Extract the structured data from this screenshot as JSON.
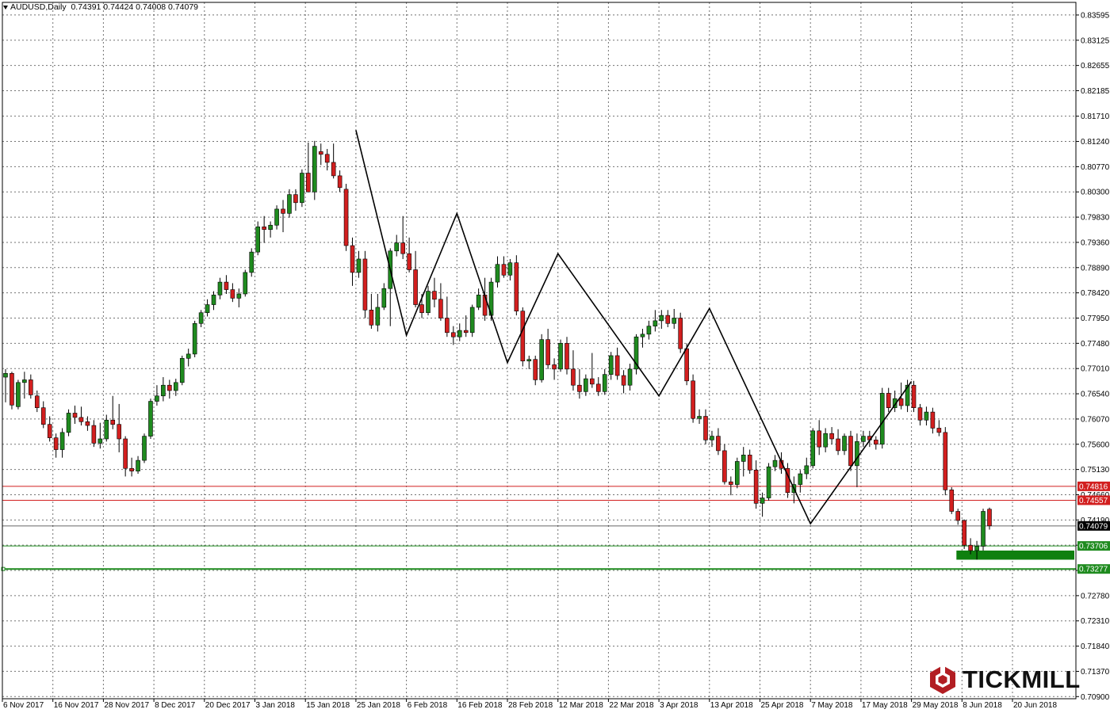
{
  "header": {
    "symbol": "AUDUSD,Daily",
    "ohlc": "0.74391 0.74424 0.74008 0.74079"
  },
  "logo": {
    "text": "TICKMILL",
    "icon": "tickmill-hexagon-icon",
    "color": "#b21e23"
  },
  "colors": {
    "bull": "#1f8b1f",
    "bear": "#d21f1f",
    "resistance": "#d21f1f",
    "support": "#1f8b1f",
    "current_price": "#000000",
    "grid": "#000000"
  },
  "chart_data": {
    "type": "candlestick",
    "symbol": "AUDUSD",
    "timeframe": "Daily",
    "ylim": [
      0.7086,
      0.8383
    ],
    "y_ticks": [
      "0.83595",
      "0.83125",
      "0.82655",
      "0.82185",
      "0.81710",
      "0.81240",
      "0.80770",
      "0.80300",
      "0.79830",
      "0.79360",
      "0.78890",
      "0.78420",
      "0.77950",
      "0.77480",
      "0.77010",
      "0.76540",
      "0.76070",
      "0.75600",
      "0.75130",
      "0.74660",
      "0.74190",
      "0.73720",
      "0.73250",
      "0.72780",
      "0.72310",
      "0.71840",
      "0.71370",
      "0.70900"
    ],
    "x_ticks": [
      "6 Nov 2017",
      "16 Nov 2017",
      "28 Nov 2017",
      "8 Dec 2017",
      "20 Dec 2017",
      "3 Jan 2018",
      "15 Jan 2018",
      "25 Jan 2018",
      "6 Feb 2018",
      "16 Feb 2018",
      "28 Feb 2018",
      "12 Mar 2018",
      "22 Mar 2018",
      "3 Apr 2018",
      "13 Apr 2018",
      "25 Apr 2018",
      "7 May 2018",
      "17 May 2018",
      "29 May 2018",
      "8 Jun 2018",
      "20 Jun 2018"
    ],
    "grid": true,
    "horizontal_levels": [
      {
        "value": 0.74816,
        "label": "0.74816",
        "color": "#d21f1f"
      },
      {
        "value": 0.74557,
        "label": "0.74557",
        "color": "#d21f1f"
      },
      {
        "value": 0.74079,
        "label": "0.74079",
        "color": "#000000",
        "current": true
      },
      {
        "value": 0.73706,
        "label": "0.73706",
        "color": "#1f8b1f"
      },
      {
        "value": 0.73277,
        "label": "0.73277",
        "color": "#1f8b1f"
      }
    ],
    "support_zone": {
      "from": 0.7345,
      "to": 0.7362,
      "start_date": "8 Jun 2018",
      "color": "#0f800f"
    },
    "zigzag": [
      {
        "x": "25 Jan 2018",
        "y": 0.8145
      },
      {
        "x": "6 Feb 2018",
        "y": 0.7763
      },
      {
        "x": "16 Feb 2018",
        "y": 0.799
      },
      {
        "x": "28 Feb 2018",
        "y": 0.7712
      },
      {
        "x": "12 Mar 2018",
        "y": 0.7915
      },
      {
        "x": "3 Apr 2018",
        "y": 0.765
      },
      {
        "x": "13 Apr 2018",
        "y": 0.7813
      },
      {
        "x": "7 May 2018",
        "y": 0.7412
      },
      {
        "x": "29 May 2018",
        "y": 0.7677
      }
    ],
    "candles": [
      {
        "o": 0.7685,
        "h": 0.77,
        "l": 0.7638,
        "c": 0.7692
      },
      {
        "o": 0.7692,
        "h": 0.7695,
        "l": 0.7625,
        "c": 0.7633
      },
      {
        "o": 0.763,
        "h": 0.768,
        "l": 0.7625,
        "c": 0.7675
      },
      {
        "o": 0.7675,
        "h": 0.7695,
        "l": 0.7645,
        "c": 0.768
      },
      {
        "o": 0.768,
        "h": 0.769,
        "l": 0.7645,
        "c": 0.7652
      },
      {
        "o": 0.765,
        "h": 0.766,
        "l": 0.762,
        "c": 0.7628
      },
      {
        "o": 0.7628,
        "h": 0.764,
        "l": 0.759,
        "c": 0.7597
      },
      {
        "o": 0.7597,
        "h": 0.7612,
        "l": 0.7565,
        "c": 0.7572
      },
      {
        "o": 0.7572,
        "h": 0.758,
        "l": 0.7535,
        "c": 0.755
      },
      {
        "o": 0.755,
        "h": 0.759,
        "l": 0.7535,
        "c": 0.7582
      },
      {
        "o": 0.7582,
        "h": 0.7625,
        "l": 0.7575,
        "c": 0.7618
      },
      {
        "o": 0.7618,
        "h": 0.7632,
        "l": 0.7598,
        "c": 0.761
      },
      {
        "o": 0.761,
        "h": 0.763,
        "l": 0.7595,
        "c": 0.7602
      },
      {
        "o": 0.7602,
        "h": 0.7612,
        "l": 0.7585,
        "c": 0.7595
      },
      {
        "o": 0.7595,
        "h": 0.7605,
        "l": 0.7555,
        "c": 0.7562
      },
      {
        "o": 0.7562,
        "h": 0.76,
        "l": 0.7552,
        "c": 0.757
      },
      {
        "o": 0.757,
        "h": 0.7615,
        "l": 0.7565,
        "c": 0.7605
      },
      {
        "o": 0.7605,
        "h": 0.765,
        "l": 0.7588,
        "c": 0.7597
      },
      {
        "o": 0.7597,
        "h": 0.7635,
        "l": 0.7545,
        "c": 0.757
      },
      {
        "o": 0.757,
        "h": 0.7575,
        "l": 0.75,
        "c": 0.7515
      },
      {
        "o": 0.7515,
        "h": 0.7535,
        "l": 0.75,
        "c": 0.751
      },
      {
        "o": 0.751,
        "h": 0.7538,
        "l": 0.7505,
        "c": 0.753
      },
      {
        "o": 0.753,
        "h": 0.758,
        "l": 0.7525,
        "c": 0.7575
      },
      {
        "o": 0.7575,
        "h": 0.7645,
        "l": 0.757,
        "c": 0.764
      },
      {
        "o": 0.764,
        "h": 0.767,
        "l": 0.7632,
        "c": 0.765
      },
      {
        "o": 0.765,
        "h": 0.7685,
        "l": 0.764,
        "c": 0.767
      },
      {
        "o": 0.767,
        "h": 0.768,
        "l": 0.7645,
        "c": 0.766
      },
      {
        "o": 0.766,
        "h": 0.7682,
        "l": 0.765,
        "c": 0.7675
      },
      {
        "o": 0.7675,
        "h": 0.7725,
        "l": 0.767,
        "c": 0.772
      },
      {
        "o": 0.772,
        "h": 0.7738,
        "l": 0.7705,
        "c": 0.7728
      },
      {
        "o": 0.7728,
        "h": 0.779,
        "l": 0.7722,
        "c": 0.7785
      },
      {
        "o": 0.7785,
        "h": 0.781,
        "l": 0.7778,
        "c": 0.7805
      },
      {
        "o": 0.7805,
        "h": 0.783,
        "l": 0.7798,
        "c": 0.782
      },
      {
        "o": 0.782,
        "h": 0.7845,
        "l": 0.781,
        "c": 0.7838
      },
      {
        "o": 0.7838,
        "h": 0.787,
        "l": 0.783,
        "c": 0.7862
      },
      {
        "o": 0.7862,
        "h": 0.7875,
        "l": 0.784,
        "c": 0.7848
      },
      {
        "o": 0.7848,
        "h": 0.786,
        "l": 0.7825,
        "c": 0.7832
      },
      {
        "o": 0.7832,
        "h": 0.785,
        "l": 0.7815,
        "c": 0.784
      },
      {
        "o": 0.784,
        "h": 0.7885,
        "l": 0.7835,
        "c": 0.788
      },
      {
        "o": 0.788,
        "h": 0.7925,
        "l": 0.7872,
        "c": 0.7918
      },
      {
        "o": 0.7918,
        "h": 0.7975,
        "l": 0.7912,
        "c": 0.7965
      },
      {
        "o": 0.7965,
        "h": 0.7985,
        "l": 0.7935,
        "c": 0.796
      },
      {
        "o": 0.796,
        "h": 0.7975,
        "l": 0.7945,
        "c": 0.7968
      },
      {
        "o": 0.7968,
        "h": 0.8005,
        "l": 0.796,
        "c": 0.7998
      },
      {
        "o": 0.7998,
        "h": 0.8015,
        "l": 0.7955,
        "c": 0.799
      },
      {
        "o": 0.799,
        "h": 0.8035,
        "l": 0.7982,
        "c": 0.8025
      },
      {
        "o": 0.8025,
        "h": 0.8035,
        "l": 0.7995,
        "c": 0.801
      },
      {
        "o": 0.801,
        "h": 0.8072,
        "l": 0.8002,
        "c": 0.8065
      },
      {
        "o": 0.8065,
        "h": 0.8122,
        "l": 0.803,
        "c": 0.803
      },
      {
        "o": 0.803,
        "h": 0.8125,
        "l": 0.8015,
        "c": 0.8115
      },
      {
        "o": 0.8105,
        "h": 0.812,
        "l": 0.808,
        "c": 0.81
      },
      {
        "o": 0.81,
        "h": 0.811,
        "l": 0.807,
        "c": 0.8085
      },
      {
        "o": 0.8085,
        "h": 0.812,
        "l": 0.8055,
        "c": 0.806
      },
      {
        "o": 0.806,
        "h": 0.807,
        "l": 0.803,
        "c": 0.8038
      },
      {
        "o": 0.8035,
        "h": 0.8045,
        "l": 0.792,
        "c": 0.793
      },
      {
        "o": 0.793,
        "h": 0.7945,
        "l": 0.7855,
        "c": 0.788
      },
      {
        "o": 0.788,
        "h": 0.792,
        "l": 0.787,
        "c": 0.7905
      },
      {
        "o": 0.7905,
        "h": 0.792,
        "l": 0.7795,
        "c": 0.781
      },
      {
        "o": 0.781,
        "h": 0.784,
        "l": 0.7775,
        "c": 0.7782
      },
      {
        "o": 0.7782,
        "h": 0.784,
        "l": 0.777,
        "c": 0.7815
      },
      {
        "o": 0.7815,
        "h": 0.786,
        "l": 0.781,
        "c": 0.785
      },
      {
        "o": 0.785,
        "h": 0.7925,
        "l": 0.778,
        "c": 0.792
      },
      {
        "o": 0.792,
        "h": 0.795,
        "l": 0.791,
        "c": 0.7935
      },
      {
        "o": 0.7935,
        "h": 0.7985,
        "l": 0.7905,
        "c": 0.7915
      },
      {
        "o": 0.7915,
        "h": 0.7945,
        "l": 0.788,
        "c": 0.7885
      },
      {
        "o": 0.7885,
        "h": 0.792,
        "l": 0.7815,
        "c": 0.782
      },
      {
        "o": 0.782,
        "h": 0.784,
        "l": 0.7795,
        "c": 0.7805
      },
      {
        "o": 0.7805,
        "h": 0.7855,
        "l": 0.78,
        "c": 0.7845
      },
      {
        "o": 0.7845,
        "h": 0.787,
        "l": 0.7815,
        "c": 0.783
      },
      {
        "o": 0.783,
        "h": 0.786,
        "l": 0.779,
        "c": 0.7795
      },
      {
        "o": 0.7795,
        "h": 0.7835,
        "l": 0.776,
        "c": 0.7768
      },
      {
        "o": 0.7768,
        "h": 0.778,
        "l": 0.7745,
        "c": 0.776
      },
      {
        "o": 0.776,
        "h": 0.7785,
        "l": 0.7752,
        "c": 0.7772
      },
      {
        "o": 0.7772,
        "h": 0.78,
        "l": 0.776,
        "c": 0.7768
      },
      {
        "o": 0.7768,
        "h": 0.782,
        "l": 0.776,
        "c": 0.7815
      },
      {
        "o": 0.7815,
        "h": 0.785,
        "l": 0.781,
        "c": 0.7838
      },
      {
        "o": 0.7838,
        "h": 0.787,
        "l": 0.779,
        "c": 0.78
      },
      {
        "o": 0.78,
        "h": 0.787,
        "l": 0.779,
        "c": 0.7862
      },
      {
        "o": 0.7862,
        "h": 0.791,
        "l": 0.7852,
        "c": 0.7895
      },
      {
        "o": 0.7895,
        "h": 0.791,
        "l": 0.787,
        "c": 0.7875
      },
      {
        "o": 0.7875,
        "h": 0.7905,
        "l": 0.7865,
        "c": 0.7898
      },
      {
        "o": 0.7898,
        "h": 0.7912,
        "l": 0.78,
        "c": 0.7808
      },
      {
        "o": 0.7808,
        "h": 0.7815,
        "l": 0.7705,
        "c": 0.7715
      },
      {
        "o": 0.7715,
        "h": 0.7725,
        "l": 0.77,
        "c": 0.7718
      },
      {
        "o": 0.7718,
        "h": 0.7725,
        "l": 0.767,
        "c": 0.768
      },
      {
        "o": 0.768,
        "h": 0.7765,
        "l": 0.7675,
        "c": 0.7755
      },
      {
        "o": 0.7755,
        "h": 0.7775,
        "l": 0.77,
        "c": 0.7708
      },
      {
        "o": 0.7708,
        "h": 0.772,
        "l": 0.768,
        "c": 0.77
      },
      {
        "o": 0.77,
        "h": 0.7755,
        "l": 0.7695,
        "c": 0.7748
      },
      {
        "o": 0.7748,
        "h": 0.776,
        "l": 0.769,
        "c": 0.77
      },
      {
        "o": 0.77,
        "h": 0.7735,
        "l": 0.766,
        "c": 0.767
      },
      {
        "o": 0.767,
        "h": 0.77,
        "l": 0.7645,
        "c": 0.7658
      },
      {
        "o": 0.7658,
        "h": 0.769,
        "l": 0.765,
        "c": 0.7682
      },
      {
        "o": 0.7682,
        "h": 0.773,
        "l": 0.7665,
        "c": 0.7672
      },
      {
        "o": 0.7672,
        "h": 0.7685,
        "l": 0.765,
        "c": 0.7658
      },
      {
        "o": 0.7658,
        "h": 0.77,
        "l": 0.7652,
        "c": 0.769
      },
      {
        "o": 0.769,
        "h": 0.7732,
        "l": 0.768,
        "c": 0.7725
      },
      {
        "o": 0.7725,
        "h": 0.774,
        "l": 0.768,
        "c": 0.7688
      },
      {
        "o": 0.7688,
        "h": 0.7698,
        "l": 0.7655,
        "c": 0.767
      },
      {
        "o": 0.767,
        "h": 0.771,
        "l": 0.766,
        "c": 0.77
      },
      {
        "o": 0.77,
        "h": 0.7765,
        "l": 0.769,
        "c": 0.776
      },
      {
        "o": 0.776,
        "h": 0.7775,
        "l": 0.774,
        "c": 0.7765
      },
      {
        "o": 0.7765,
        "h": 0.779,
        "l": 0.7755,
        "c": 0.778
      },
      {
        "o": 0.778,
        "h": 0.781,
        "l": 0.777,
        "c": 0.779
      },
      {
        "o": 0.779,
        "h": 0.781,
        "l": 0.7775,
        "c": 0.78
      },
      {
        "o": 0.78,
        "h": 0.781,
        "l": 0.7778,
        "c": 0.7785
      },
      {
        "o": 0.7785,
        "h": 0.7812,
        "l": 0.7775,
        "c": 0.7795
      },
      {
        "o": 0.7795,
        "h": 0.7805,
        "l": 0.773,
        "c": 0.7738
      },
      {
        "o": 0.7738,
        "h": 0.7748,
        "l": 0.767,
        "c": 0.7678
      },
      {
        "o": 0.7678,
        "h": 0.769,
        "l": 0.76,
        "c": 0.7608
      },
      {
        "o": 0.7608,
        "h": 0.7625,
        "l": 0.7598,
        "c": 0.7612
      },
      {
        "o": 0.7612,
        "h": 0.7625,
        "l": 0.756,
        "c": 0.7568
      },
      {
        "o": 0.7568,
        "h": 0.7585,
        "l": 0.7555,
        "c": 0.7575
      },
      {
        "o": 0.7575,
        "h": 0.759,
        "l": 0.754,
        "c": 0.7548
      },
      {
        "o": 0.7548,
        "h": 0.756,
        "l": 0.7485,
        "c": 0.749
      },
      {
        "o": 0.749,
        "h": 0.75,
        "l": 0.7465,
        "c": 0.7485
      },
      {
        "o": 0.7485,
        "h": 0.7535,
        "l": 0.7478,
        "c": 0.7528
      },
      {
        "o": 0.7528,
        "h": 0.7555,
        "l": 0.75,
        "c": 0.754
      },
      {
        "o": 0.754,
        "h": 0.755,
        "l": 0.7505,
        "c": 0.7512
      },
      {
        "o": 0.7512,
        "h": 0.753,
        "l": 0.744,
        "c": 0.745
      },
      {
        "o": 0.745,
        "h": 0.747,
        "l": 0.7425,
        "c": 0.746
      },
      {
        "o": 0.746,
        "h": 0.7525,
        "l": 0.7455,
        "c": 0.7518
      },
      {
        "o": 0.7518,
        "h": 0.754,
        "l": 0.751,
        "c": 0.753
      },
      {
        "o": 0.753,
        "h": 0.7545,
        "l": 0.7505,
        "c": 0.7515
      },
      {
        "o": 0.7515,
        "h": 0.7525,
        "l": 0.746,
        "c": 0.747
      },
      {
        "o": 0.747,
        "h": 0.75,
        "l": 0.745,
        "c": 0.7485
      },
      {
        "o": 0.7485,
        "h": 0.7512,
        "l": 0.747,
        "c": 0.7505
      },
      {
        "o": 0.7505,
        "h": 0.7535,
        "l": 0.7495,
        "c": 0.752
      },
      {
        "o": 0.752,
        "h": 0.759,
        "l": 0.7515,
        "c": 0.7585
      },
      {
        "o": 0.7585,
        "h": 0.7605,
        "l": 0.754,
        "c": 0.7555
      },
      {
        "o": 0.7555,
        "h": 0.759,
        "l": 0.7545,
        "c": 0.758
      },
      {
        "o": 0.758,
        "h": 0.7592,
        "l": 0.756,
        "c": 0.757
      },
      {
        "o": 0.757,
        "h": 0.7588,
        "l": 0.754,
        "c": 0.7548
      },
      {
        "o": 0.7548,
        "h": 0.758,
        "l": 0.754,
        "c": 0.7575
      },
      {
        "o": 0.7575,
        "h": 0.7585,
        "l": 0.751,
        "c": 0.752
      },
      {
        "o": 0.752,
        "h": 0.758,
        "l": 0.748,
        "c": 0.7565
      },
      {
        "o": 0.7565,
        "h": 0.7585,
        "l": 0.7555,
        "c": 0.7575
      },
      {
        "o": 0.7575,
        "h": 0.7585,
        "l": 0.7555,
        "c": 0.7568
      },
      {
        "o": 0.7568,
        "h": 0.7575,
        "l": 0.755,
        "c": 0.756
      },
      {
        "o": 0.756,
        "h": 0.7665,
        "l": 0.7552,
        "c": 0.7655
      },
      {
        "o": 0.7655,
        "h": 0.7665,
        "l": 0.762,
        "c": 0.7628
      },
      {
        "o": 0.7628,
        "h": 0.766,
        "l": 0.762,
        "c": 0.7645
      },
      {
        "o": 0.7645,
        "h": 0.7675,
        "l": 0.7625,
        "c": 0.7632
      },
      {
        "o": 0.7632,
        "h": 0.768,
        "l": 0.762,
        "c": 0.767
      },
      {
        "o": 0.767,
        "h": 0.7678,
        "l": 0.762,
        "c": 0.7628
      },
      {
        "o": 0.7628,
        "h": 0.7635,
        "l": 0.7595,
        "c": 0.7605
      },
      {
        "o": 0.7605,
        "h": 0.763,
        "l": 0.7595,
        "c": 0.762
      },
      {
        "o": 0.762,
        "h": 0.7628,
        "l": 0.758,
        "c": 0.759
      },
      {
        "o": 0.759,
        "h": 0.7605,
        "l": 0.7575,
        "c": 0.7582
      },
      {
        "o": 0.7582,
        "h": 0.7592,
        "l": 0.7465,
        "c": 0.7475
      },
      {
        "o": 0.7475,
        "h": 0.748,
        "l": 0.743,
        "c": 0.7435
      },
      {
        "o": 0.7435,
        "h": 0.744,
        "l": 0.741,
        "c": 0.7418
      },
      {
        "o": 0.7418,
        "h": 0.742,
        "l": 0.7365,
        "c": 0.7372
      },
      {
        "o": 0.7372,
        "h": 0.7385,
        "l": 0.7355,
        "c": 0.7362
      },
      {
        "o": 0.7362,
        "h": 0.738,
        "l": 0.7345,
        "c": 0.737
      },
      {
        "o": 0.737,
        "h": 0.744,
        "l": 0.7362,
        "c": 0.7435
      },
      {
        "o": 0.7439,
        "h": 0.7442,
        "l": 0.7401,
        "c": 0.7408
      }
    ]
  }
}
